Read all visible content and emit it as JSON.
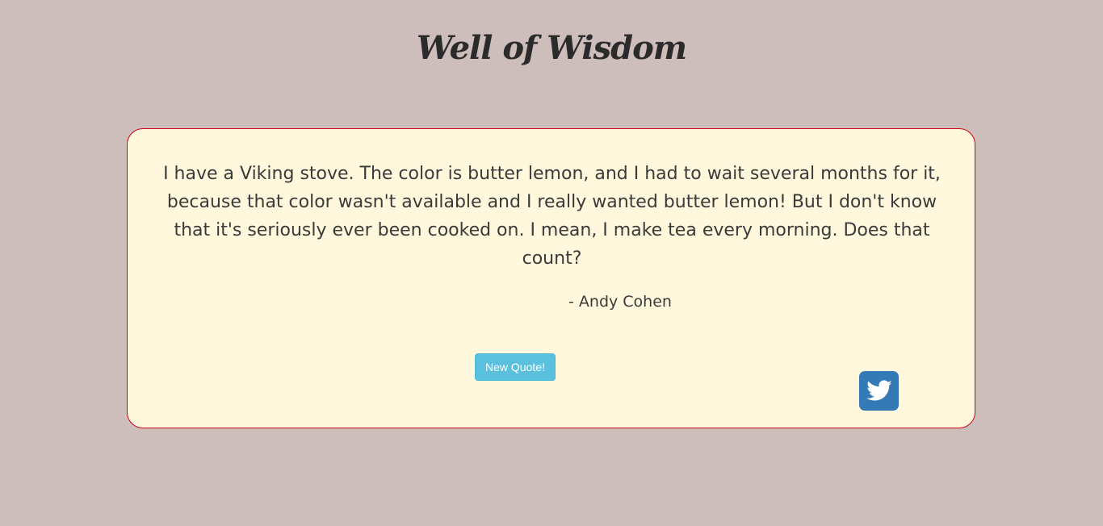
{
  "header": {
    "title": "Well of Wisdom"
  },
  "card": {
    "quote": "I have a Viking stove. The color is butter lemon, and I had to wait several months for it, because that color wasn't available and I really wanted butter lemon! But I don't know that it's seriously ever been cooked on. I mean, I make tea every morning. Does that count?",
    "author": "- Andy Cohen",
    "new_quote_label": "New Quote!",
    "tweet_icon": "twitter-icon"
  },
  "colors": {
    "background": "#cdbdbb",
    "card_background": "#fff8dc",
    "card_border": "#d0021b",
    "button": "#5bc0de",
    "twitter_button": "#337ab7"
  }
}
